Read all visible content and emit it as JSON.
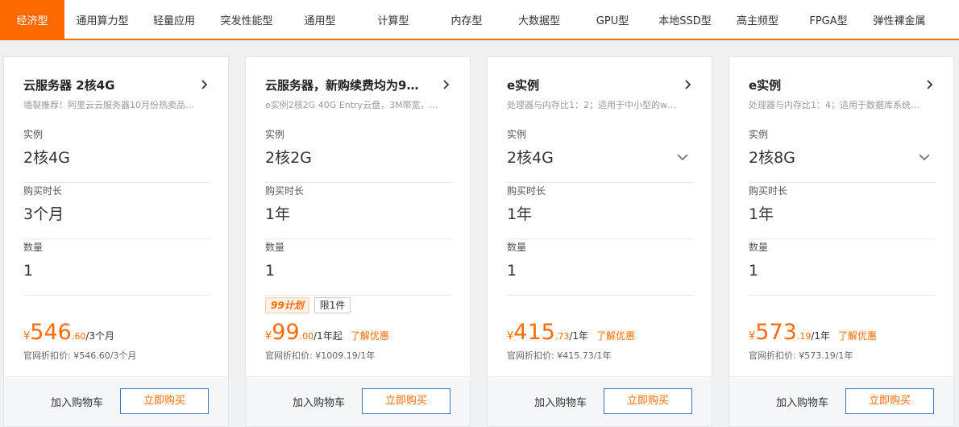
{
  "tabs": [
    {
      "label": "经济型",
      "active": true
    },
    {
      "label": "通用算力型"
    },
    {
      "label": "轻量应用"
    },
    {
      "label": "突发性能型"
    },
    {
      "label": "通用型"
    },
    {
      "label": "计算型"
    },
    {
      "label": "内存型"
    },
    {
      "label": "大数据型"
    },
    {
      "label": "GPU型"
    },
    {
      "label": "本地SSD型"
    },
    {
      "label": "高主频型"
    },
    {
      "label": "FPGA型"
    },
    {
      "label": "弹性裸金属"
    }
  ],
  "field_labels": {
    "instance": "实例",
    "duration": "购买时长",
    "quantity": "数量"
  },
  "footer": {
    "cart": "加入购物车",
    "buy": "立即购买"
  },
  "colors": {
    "accent": "#ff6a00",
    "buy_border": "#3777c2"
  },
  "icons": {
    "header": "chevron-right-icon",
    "select": "chevron-down-icon"
  },
  "cards": [
    {
      "title": "云服务器 2核4G",
      "desc": "墙裂推荐！阿里云云服务器10月份热卖品…",
      "instance": "2核4G",
      "duration": "3个月",
      "quantity": "1",
      "currency": "¥",
      "price_int": "546",
      "price_dec": ".60",
      "price_unit": "/3个月",
      "official": "官网折扣价: ¥546.60/3个月"
    },
    {
      "title": "云服务器，新购续费均为9…",
      "desc": "e实例2核2G 40G Entry云盘，3M带宽，…",
      "instance": "2核2G",
      "duration": "1年",
      "quantity": "1",
      "badge_plan": "99计划",
      "badge_limit": "限1件",
      "currency": "¥",
      "price_int": "99",
      "price_dec": ".00",
      "price_unit": "/1年起",
      "discount_link": "了解优惠",
      "official": "官网折扣价: ¥1009.19/1年"
    },
    {
      "title": "e实例",
      "desc": "处理器与内存比1：2；适用于中小型的w…",
      "instance": "2核4G",
      "duration": "1年",
      "quantity": "1",
      "currency": "¥",
      "price_int": "415",
      "price_dec": ".73",
      "price_unit": "/1年",
      "discount_link": "了解优惠",
      "official": "官网折扣价: ¥415.73/1年"
    },
    {
      "title": "e实例",
      "desc": "处理器与内存比1：4；适用于数据库系统…",
      "instance": "2核8G",
      "duration": "1年",
      "quantity": "1",
      "currency": "¥",
      "price_int": "573",
      "price_dec": ".19",
      "price_unit": "/1年",
      "discount_link": "了解优惠",
      "official": "官网折扣价: ¥573.19/1年"
    }
  ]
}
